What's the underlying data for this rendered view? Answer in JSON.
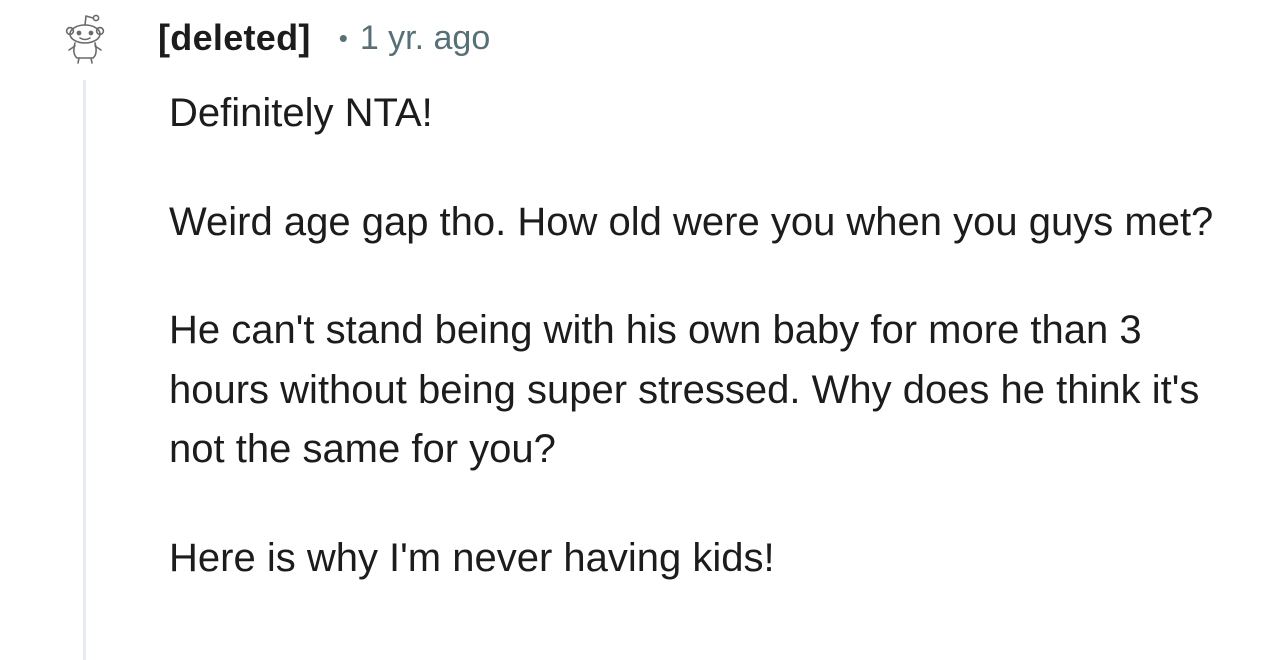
{
  "comment": {
    "author": "[deleted]",
    "separator": "•",
    "timestamp": "1 yr. ago",
    "avatar_icon": "reddit-snoo-outline-icon",
    "paragraphs": [
      "Definitely NTA!",
      "Weird age gap tho. How old were you when you guys met?",
      "He can't stand being with his own baby for more than 3 hours without being super stressed. Why does he think it's not the same for you?",
      "Here is why I'm never having kids!"
    ]
  },
  "colors": {
    "text": "#1c1c1c",
    "meta": "#576f76",
    "thread_line": "#e5ebee",
    "background": "#ffffff"
  }
}
